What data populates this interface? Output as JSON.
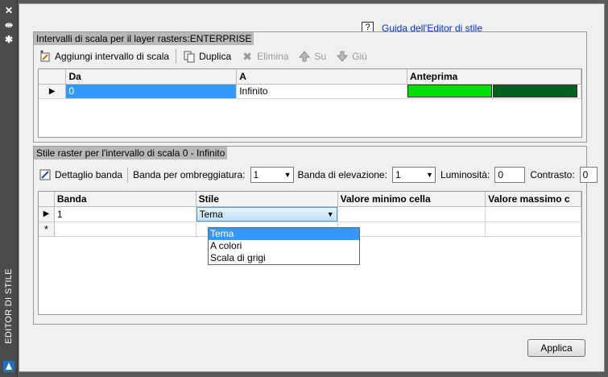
{
  "sidebar": {
    "title": "EDITOR DI STILE"
  },
  "help": {
    "icon_text": "?",
    "link": "Guida dell'Editor di stile"
  },
  "scale_section": {
    "title": "Intervalli di scala per il layer rasters:ENTERPRISE",
    "toolbar": {
      "add": "Aggiungi intervallo di scala",
      "duplicate": "Duplica",
      "delete": "Elimina",
      "up": "Su",
      "down": "Giù"
    },
    "columns": [
      "Da",
      "A",
      "Anteprima"
    ],
    "rows": [
      {
        "from": "0",
        "to": "Infinito",
        "preview_colors": [
          "#00e000",
          "#006020"
        ]
      }
    ]
  },
  "raster_section": {
    "title": "Stile raster per l'intervallo di scala 0 - Infinito",
    "toolbar": {
      "band_detail": "Dettaglio banda",
      "shading_label": "Banda per ombreggiatura:",
      "shading_value": "1",
      "elevation_label": "Banda di elevazione:",
      "elevation_value": "1",
      "brightness_label": "Luminosità:",
      "brightness_value": "0",
      "contrast_label": "Contrasto:",
      "contrast_value": "0"
    },
    "columns": [
      "Banda",
      "Stile",
      "Valore minimo cella",
      "Valore massimo c"
    ],
    "rows": [
      {
        "band": "1",
        "style": "Tema",
        "min": "",
        "max": ""
      }
    ],
    "new_row_marker": "*",
    "style_options": [
      "Tema",
      "A colori",
      "Scala di grigi"
    ],
    "style_selected": "Tema"
  },
  "apply_button": "Applica",
  "colors": {
    "selection": "#3399ff",
    "preview_light": "#00e000",
    "preview_dark": "#006020"
  }
}
